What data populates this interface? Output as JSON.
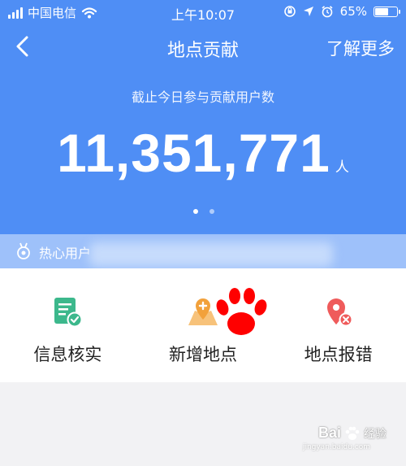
{
  "status_bar": {
    "carrier": "中国电信",
    "time": "上午10:07",
    "battery": "65%",
    "battery_level": 0.65
  },
  "navbar": {
    "title": "地点贡献",
    "more_label": "了解更多"
  },
  "hero": {
    "subtitle": "截止今日参与贡献用户数",
    "count": "11,351,771",
    "unit": "人",
    "page_indicator": {
      "active": 1,
      "total": 2
    }
  },
  "ticker": {
    "text": "热心用户"
  },
  "actions": [
    {
      "label": "信息核实",
      "icon": "verify-info-icon"
    },
    {
      "label": "新增地点",
      "icon": "add-place-icon"
    },
    {
      "label": "地点报错",
      "icon": "report-error-icon"
    }
  ],
  "watermark": {
    "brand": "Bai",
    "suffix": "经验",
    "sub": "jingyan.baidu.com"
  },
  "colors": {
    "hero_blue": "#4f8ef5",
    "ticker_blue": "#9ec1fa",
    "verify_green": "#3cb88c",
    "add_orange": "#f2a13b",
    "error_red": "#ef5b5b",
    "paw_red": "#ff0000"
  }
}
